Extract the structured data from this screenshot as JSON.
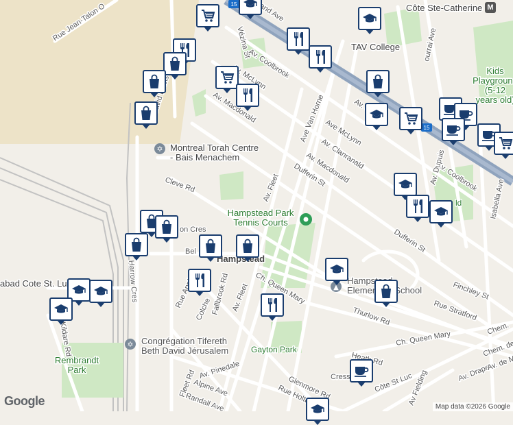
{
  "streets": {
    "jean_talon": "Rue Jean-Talon O",
    "coolbrook_1": "Av. Coolbrook",
    "mclynn_1": "Av. McLynn",
    "macdonald_1": "Av. Macdonald",
    "vezina": "Vézina St",
    "david_lewis": "David Lewis",
    "cleve": "Cleve Rd",
    "van_horne": "Ave Van Horne",
    "fleet_1": "Av. Fleet",
    "fleet_2": "Av. Fleet",
    "fleet_3": "Fleet Rd",
    "mclynn_2": "Ave McLynn",
    "clanranald": "Av. Clanranald",
    "macdonald_2": "Av. Macdonald",
    "dufferin_1": "Dufferin St",
    "dufferin_2": "Dufferin St",
    "coolbrook_2": "Av. Coolbrook",
    "cool_partial": "Av. Cool",
    "dupuis": "Av. Dupuis",
    "isabella": "Isabella Ave",
    "courtrai_partial": "ourrai Ave",
    "harrow": "Harrow Cres",
    "queen_mary_1": "Ch. Queen Mary",
    "queen_mary_2": "Ch. Queen Mary",
    "thurlow": "Thurlow Rd",
    "stratford": "Rue Stratford",
    "finchley": "Finchley St",
    "fallbrook": "Fallbrook Rd",
    "colchester": "Colche",
    "apple": "Rue Appl",
    "kildare": "Kildare Rd",
    "pinedale": "Av. Pinedale",
    "alpine": "Alpine Ave",
    "randall": "Randall Ave",
    "heath": "Heath Rd",
    "glenmore": "Glenmore Rd",
    "holton": "Rue Holto",
    "cote_st_luc": "Côte St Luc",
    "chemin_partial": "Chem.",
    "chem_cote": "Chem. de la",
    "fielding": "Av Fielding",
    "draper": "Av. Draper",
    "cress": "Cress",
    "belmont": "Bel",
    "cres": "on Cres",
    "grand_partial": "and Ave",
    "st_partial": "Chem. de",
    "ave_de_m": "Av. de M"
  },
  "places": {
    "cote_ste_catherine": "Côte Ste-Catherine",
    "metro_symbol": "M",
    "tav_college": "TAV College",
    "kids_playground": "Kids\nPlayground\n(5-12\nyears old)",
    "torah_centre": "Montreal Torah Centre\n- Bais Menachem",
    "hampstead_park": "Hampstead Park\nTennis Courts",
    "hampstead": "Hampstead",
    "hampstead_school": "Hampstead\nElementary School",
    "tifereth": "Congrégation Tifereth\nBeth David Jérusalem",
    "gayton_park": "Gayton Park",
    "rembrandt_park": "Rembrandt\nPark",
    "chabad": "abad Cote St. Luc",
    "park_partial": "ld"
  },
  "highway_shield": "15",
  "google_logo": "Google",
  "attribution": "Map data ©2026 Google",
  "colors": {
    "background": "#f2efe9",
    "road_minor": "#ffffff",
    "highway": "#8fa3bd",
    "park": "#cfe8c4",
    "rail": "#c2c2c2",
    "pin_border": "#1a3d6e",
    "industrial": "#ede3c8"
  },
  "pins": [
    {
      "type": "grocery-icon"
    },
    {
      "type": "school-icon"
    },
    {
      "type": "school-icon"
    },
    {
      "type": "restaurant-icon"
    },
    {
      "type": "restaurant-icon"
    },
    {
      "type": "restaurant-icon"
    },
    {
      "type": "shopping-icon"
    },
    {
      "type": "shopping-icon"
    },
    {
      "type": "shopping-icon"
    },
    {
      "type": "grocery-icon"
    },
    {
      "type": "restaurant-icon"
    },
    {
      "type": "shopping-icon"
    },
    {
      "type": "school-icon"
    },
    {
      "type": "cafe-icon"
    },
    {
      "type": "cafe-icon"
    },
    {
      "type": "grocery-icon"
    },
    {
      "type": "cafe-icon"
    },
    {
      "type": "cafe-icon"
    },
    {
      "type": "grocery-icon"
    },
    {
      "type": "school-icon"
    },
    {
      "type": "restaurant-icon"
    },
    {
      "type": "school-icon"
    },
    {
      "type": "shopping-icon"
    },
    {
      "type": "shopping-icon"
    },
    {
      "type": "shopping-icon"
    },
    {
      "type": "shopping-icon"
    },
    {
      "type": "shopping-icon"
    },
    {
      "type": "restaurant-icon"
    },
    {
      "type": "school-icon"
    },
    {
      "type": "school-icon"
    },
    {
      "type": "school-icon"
    },
    {
      "type": "restaurant-icon"
    },
    {
      "type": "school-icon"
    },
    {
      "type": "shopping-icon"
    },
    {
      "type": "cafe-icon"
    },
    {
      "type": "school-icon"
    }
  ]
}
